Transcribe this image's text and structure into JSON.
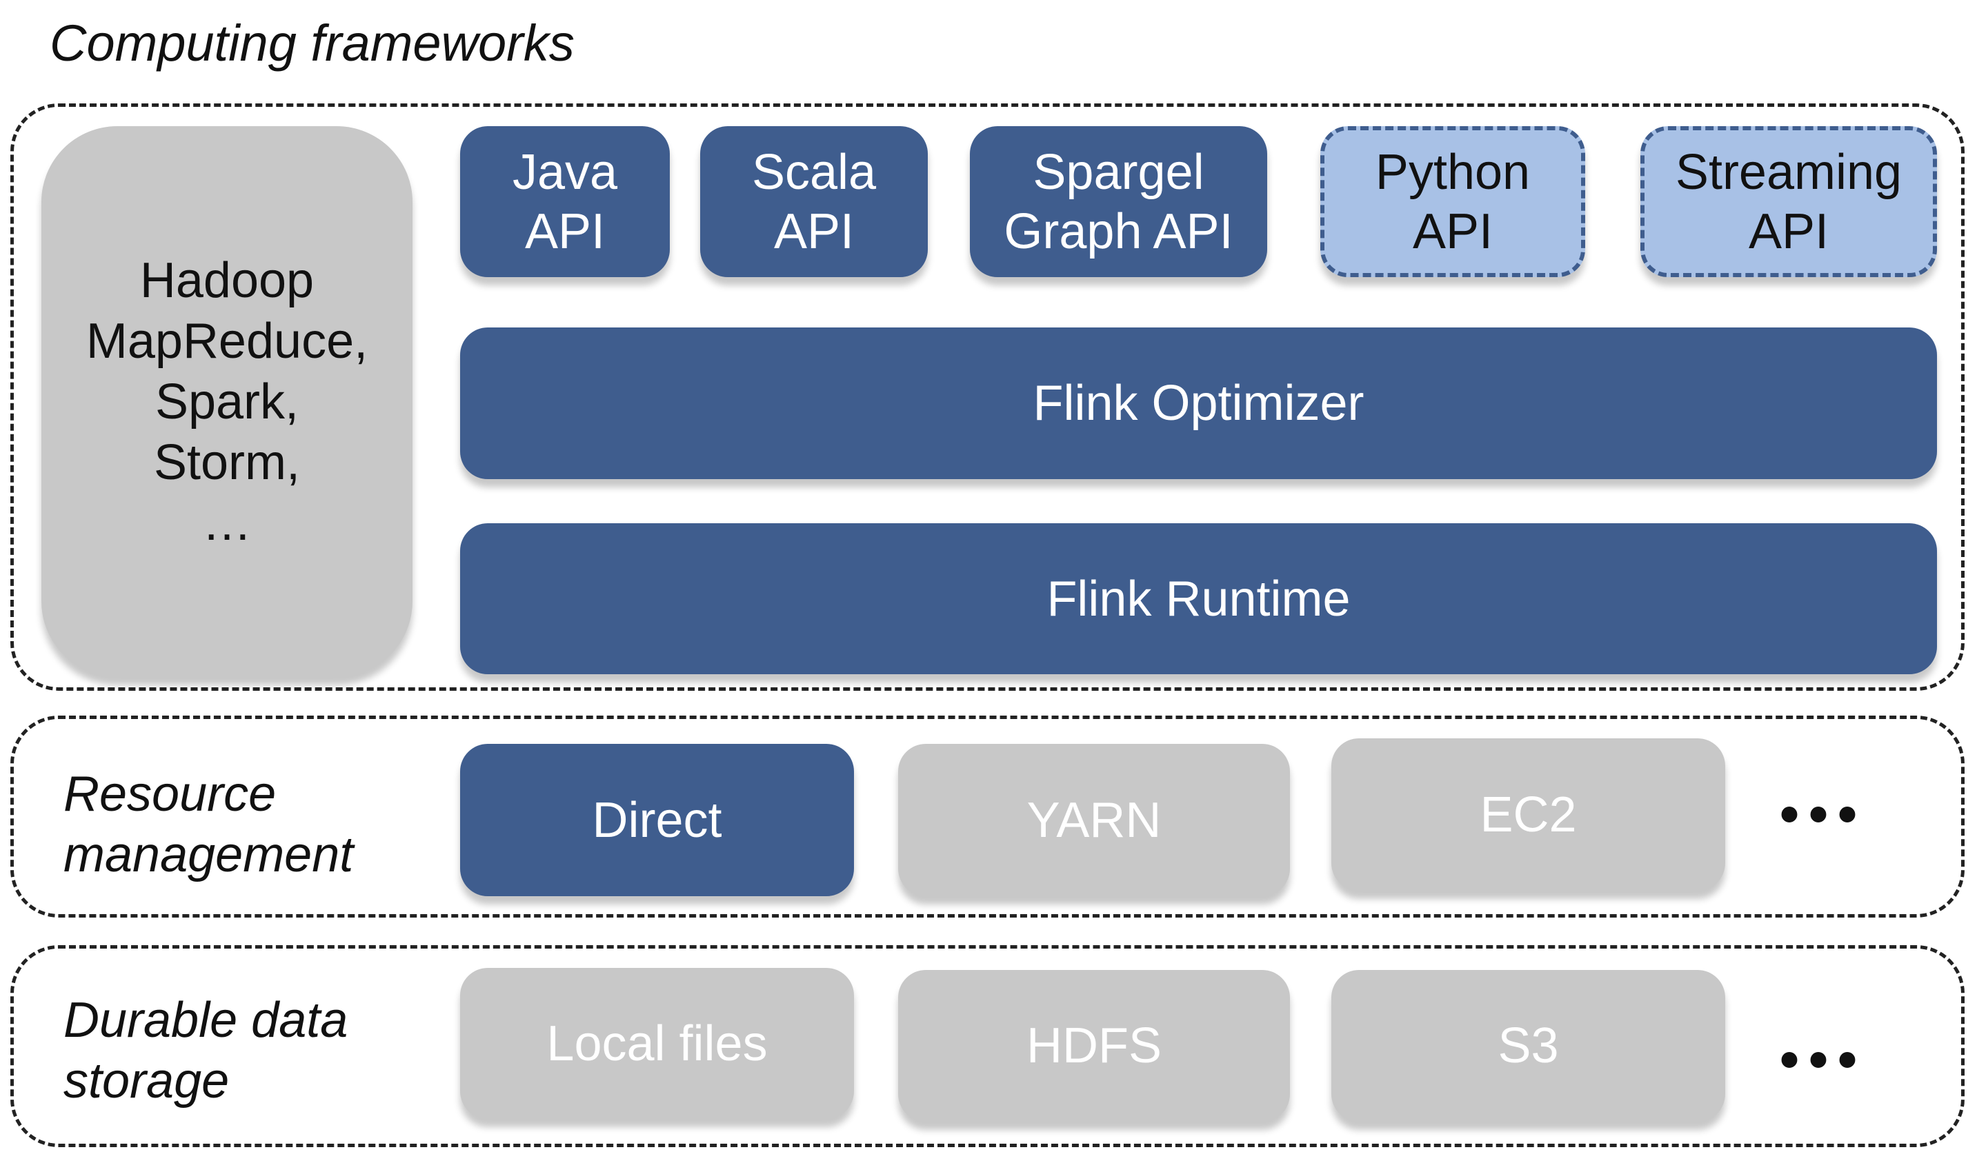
{
  "title": "Computing frameworks",
  "colors": {
    "core": "#3f5d8e",
    "planned": "#a8c1e6",
    "other": "#c8c8c8",
    "border": "#222222"
  },
  "computing": {
    "other_frameworks": "Hadoop\nMapReduce,\nSpark,\nStorm,\n…",
    "apis": [
      {
        "label": "Java\nAPI",
        "style": "core"
      },
      {
        "label": "Scala\nAPI",
        "style": "core"
      },
      {
        "label": "Spargel\nGraph API",
        "style": "core"
      },
      {
        "label": "Python\nAPI",
        "style": "planned-dashed"
      },
      {
        "label": "Streaming\nAPI",
        "style": "planned-dashed"
      }
    ],
    "optimizer": "Flink Optimizer",
    "runtime": "Flink Runtime"
  },
  "resource": {
    "label": "Resource\nmanagement",
    "items": [
      "Direct",
      "YARN",
      "EC2"
    ],
    "more": "•••"
  },
  "storage": {
    "label": "Durable data\nstorage",
    "items": [
      "Local files",
      "HDFS",
      "S3"
    ],
    "more": "•••"
  }
}
